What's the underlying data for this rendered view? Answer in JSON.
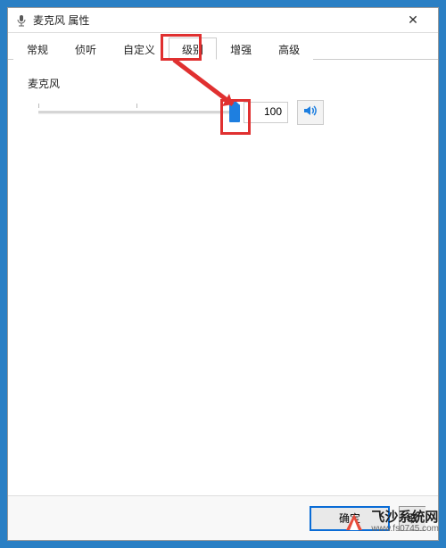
{
  "window": {
    "title": "麦克风 属性",
    "close_label": "✕"
  },
  "tabs": [
    {
      "label": "常规",
      "active": false
    },
    {
      "label": "侦听",
      "active": false
    },
    {
      "label": "自定义",
      "active": false
    },
    {
      "label": "级别",
      "active": true
    },
    {
      "label": "增强",
      "active": false
    },
    {
      "label": "高级",
      "active": false
    }
  ],
  "level_group": {
    "label": "麦克风",
    "value": "100",
    "slider_percent": 100
  },
  "buttons": {
    "ok": "确定",
    "cancel_partial": "取"
  },
  "watermark": {
    "name": "飞沙系统网",
    "url": "www.fs0745.com"
  }
}
